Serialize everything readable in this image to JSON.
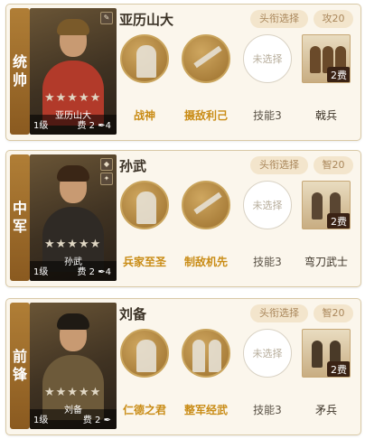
{
  "cards": [
    {
      "role": "统帅",
      "hero_name": "亚历山大",
      "hero_sub": "亚历山大",
      "level": "1级",
      "cost": "费 2",
      "weapon_count": "4",
      "title_select": "头衔选择",
      "attr": "攻20",
      "skills": [
        "战神",
        "摄敌利己",
        "技能3"
      ],
      "skill3_empty": "未选择",
      "troop_cost": "2费",
      "troop_name": "戟兵"
    },
    {
      "role": "中军",
      "hero_name": "孙武",
      "hero_sub": "孙武",
      "level": "1级",
      "cost": "费 2",
      "weapon_count": "4",
      "title_select": "头衔选择",
      "attr": "智20",
      "skills": [
        "兵家至圣",
        "制敌机先",
        "技能3"
      ],
      "skill3_empty": "未选择",
      "troop_cost": "2费",
      "troop_name": "弯刀武士"
    },
    {
      "role": "前锋",
      "hero_name": "刘备",
      "hero_sub": "刘备",
      "level": "1级",
      "cost": "费 2",
      "weapon_count": "",
      "title_select": "头衔选择",
      "attr": "智20",
      "skills": [
        "仁德之君",
        "整军经武",
        "技能3"
      ],
      "skill3_empty": "未选择",
      "troop_cost": "2费",
      "troop_name": "矛兵"
    }
  ],
  "stars": "★★★★★",
  "colors": {
    "accent_gold": "#c98c16",
    "role_strip": "#9a6a2a",
    "card_bg": "#fbf6ec"
  }
}
